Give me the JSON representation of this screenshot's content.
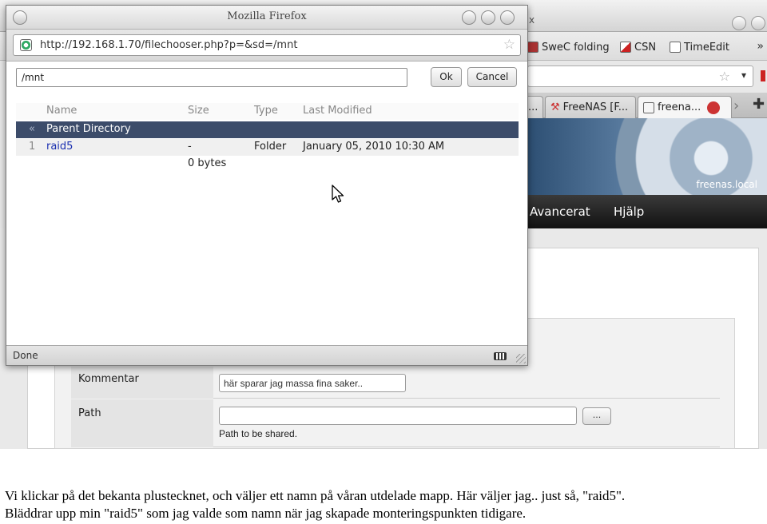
{
  "background_browser": {
    "title_fragment": "x",
    "bookmarks": [
      "SweC folding",
      "CSN",
      "TimeEdit"
    ],
    "bookmarks_more": "»",
    "tabs": [
      {
        "label": "..."
      },
      {
        "label": "FreeNAS [F..."
      },
      {
        "label": "freena..."
      }
    ],
    "host_label": "freenas.local",
    "nav_items": [
      "Avancerat",
      "Hjälp"
    ],
    "form": {
      "kommentar_label": "Kommentar",
      "kommentar_value": "här sparar jag massa fina saker..",
      "path_label": "Path",
      "path_value": "",
      "browse_label": "...",
      "path_help": "Path to be shared."
    }
  },
  "popup": {
    "title": "Mozilla Firefox",
    "url": "http://192.168.1.70/filechooser.php?p=&sd=/mnt",
    "directory_value": "/mnt",
    "ok_label": "Ok",
    "cancel_label": "Cancel",
    "table": {
      "columns": [
        "Name",
        "Size",
        "Type",
        "Last Modified"
      ],
      "parent": {
        "marker": "«",
        "name": "Parent Directory"
      },
      "rows": [
        {
          "num": "1",
          "name": "raid5",
          "size": "-",
          "type": "Folder",
          "modified": "January 05, 2010 10:30 AM"
        }
      ],
      "total": "0 bytes"
    },
    "status": "Done"
  },
  "caption": {
    "line1": "Vi klickar på det bekanta plustecknet, och väljer ett namn på våran utdelade mapp. Här väljer jag.. just så, \"raid5\".",
    "line2": "Bläddrar upp min \"raid5\" som jag valde som namn när jag skapade monteringspunkten tidigare."
  },
  "colors": {
    "selected_row": "#3c4c6a",
    "link": "#1a2fb0",
    "nav_bar": "#111111"
  }
}
